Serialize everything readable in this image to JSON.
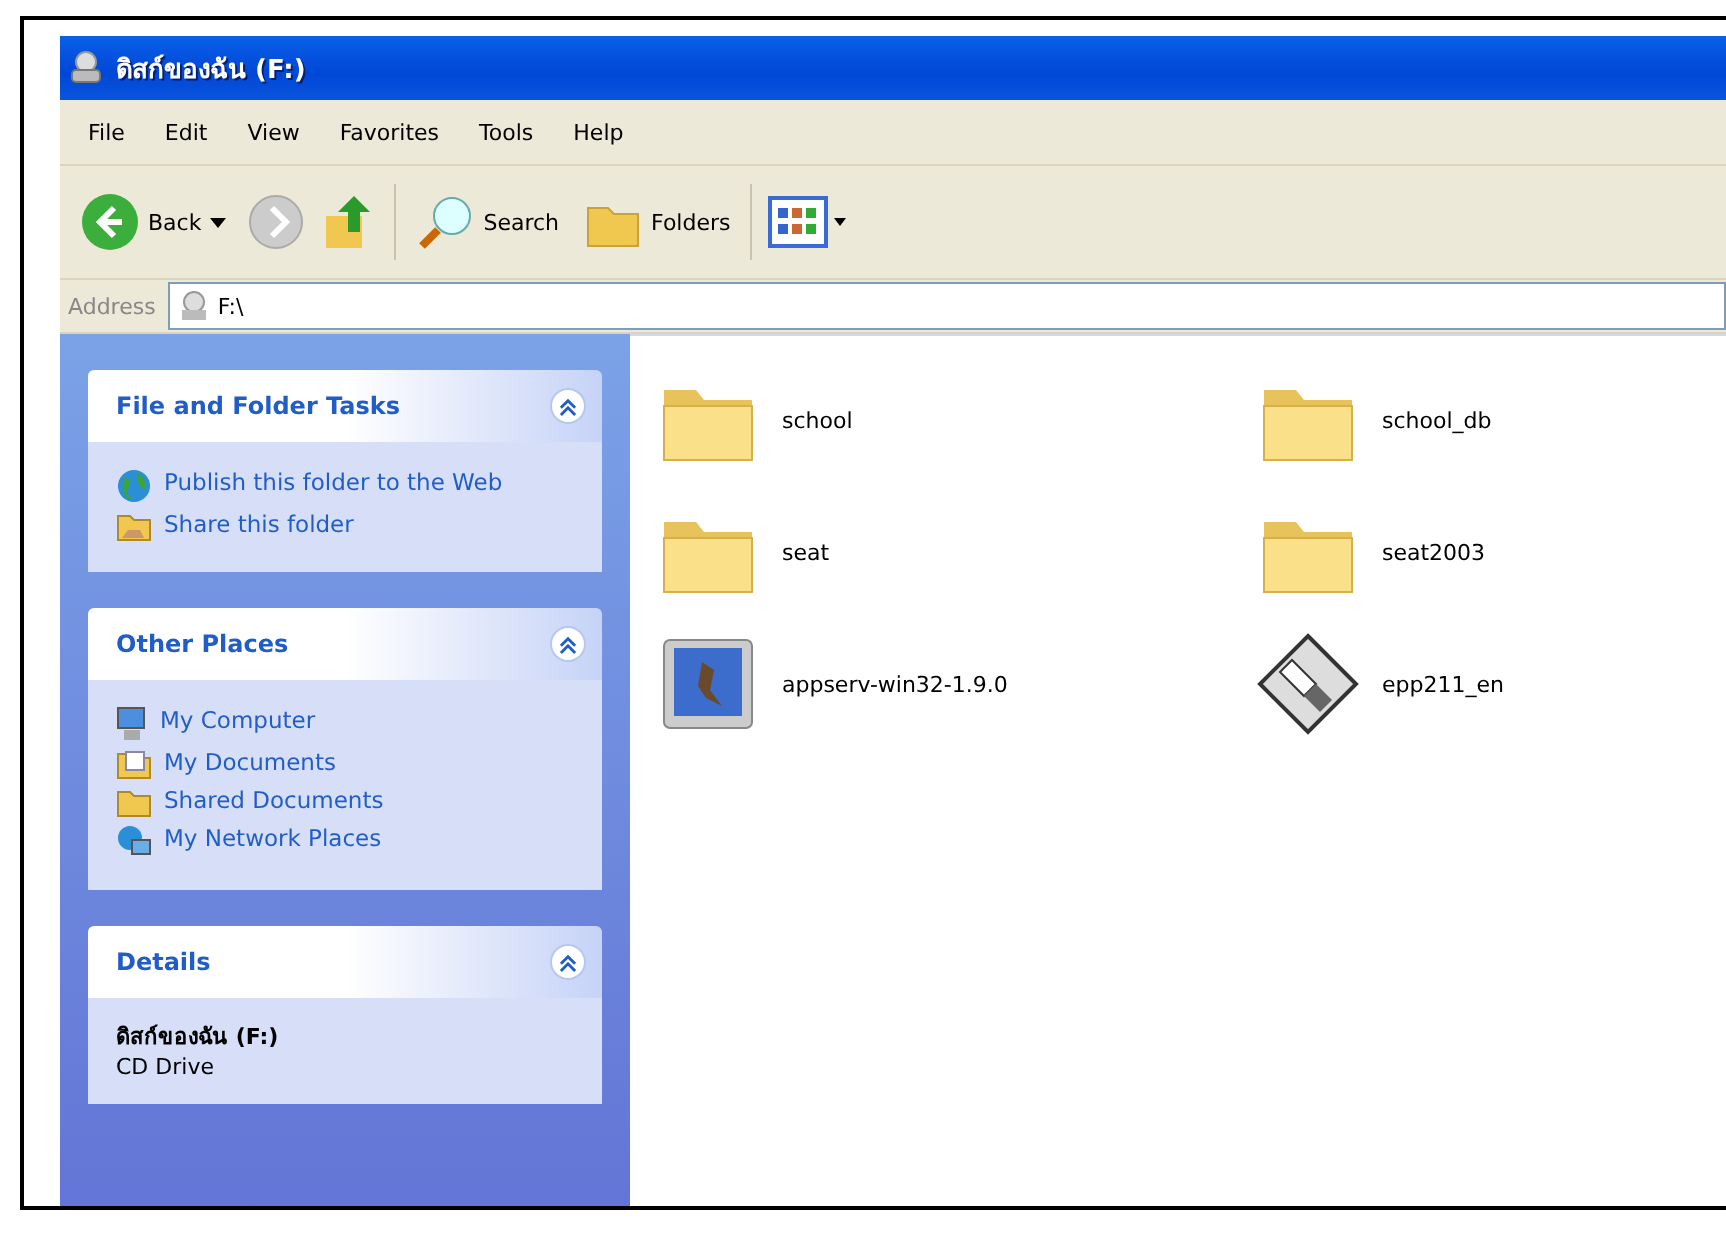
{
  "window": {
    "title": "ดิสก์ของฉัน (F:)"
  },
  "menu": [
    "File",
    "Edit",
    "View",
    "Favorites",
    "Tools",
    "Help"
  ],
  "toolbar": {
    "back": "Back",
    "search": "Search",
    "folders": "Folders"
  },
  "address": {
    "label": "Address",
    "value": "F:\\"
  },
  "panels": [
    {
      "kind": "tasks",
      "title": "File and Folder Tasks",
      "expanded": true,
      "items": [
        {
          "label": "Publish this folder to the Web",
          "kind": "globe"
        },
        {
          "label": "Share this folder",
          "kind": "share"
        }
      ]
    },
    {
      "kind": "tasks",
      "title": "Other Places",
      "expanded": true,
      "items": [
        {
          "label": "My Computer",
          "kind": "computer"
        },
        {
          "label": "My Documents",
          "kind": "documents"
        },
        {
          "label": "Shared Documents",
          "kind": "folder"
        },
        {
          "label": "My Network Places",
          "kind": "network"
        }
      ]
    },
    {
      "kind": "details",
      "title": "Details",
      "expanded": true,
      "name": "ดิสก์ของฉัน (F:)",
      "type": "CD Drive"
    }
  ],
  "files": [
    {
      "name": "school",
      "kind": "folder"
    },
    {
      "name": "school_db",
      "kind": "folder"
    },
    {
      "name": "seat",
      "kind": "folder"
    },
    {
      "name": "seat2003",
      "kind": "folder"
    },
    {
      "name": "appserv-win32-1.9.0",
      "kind": "installer"
    },
    {
      "name": "epp211_en",
      "kind": "disk"
    }
  ]
}
